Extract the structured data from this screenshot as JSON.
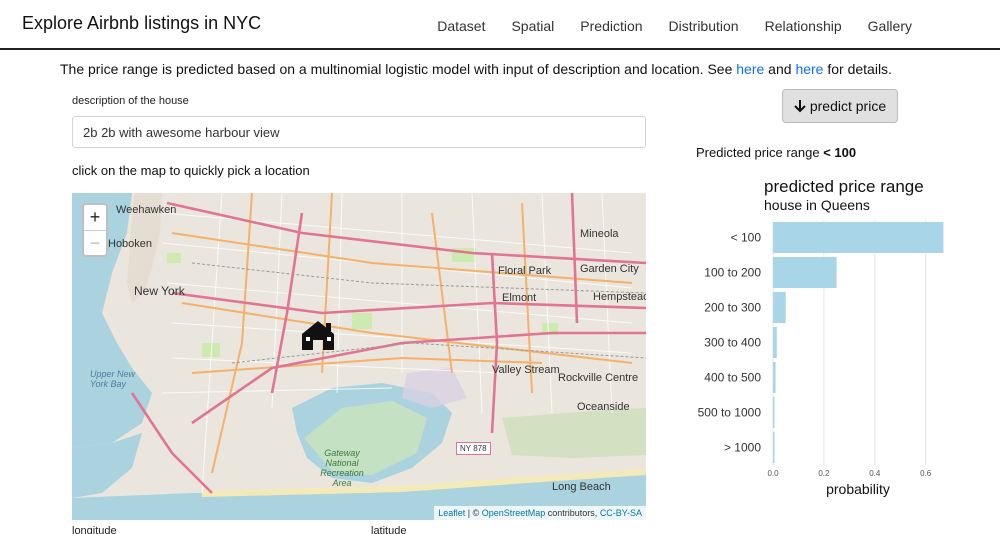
{
  "app": {
    "title": "Explore Airbnb listings in NYC",
    "nav": [
      "Dataset",
      "Spatial",
      "Prediction",
      "Distribution",
      "Relationship",
      "Gallery"
    ]
  },
  "intro": {
    "text_before": "The price range is predicted based on a multinomial logistic model with input of description and location. See ",
    "link1": "here",
    "text_mid": " and ",
    "link2": "here",
    "text_after": " for details.",
    "link_color": "#0d6efd"
  },
  "form": {
    "description_label": "description of the house",
    "description_value": "2b 2b with awesome harbour view",
    "map_hint": "click on the map to quickly pick a location",
    "longitude_label": "longitude",
    "latitude_label": "latitude"
  },
  "map": {
    "zoom_in": "+",
    "zoom_out": "−",
    "marker_icon": "house-icon",
    "labels": [
      "Weehawken",
      "Hoboken",
      "New York",
      "Upper New York Bay",
      "Gateway National Recreation Area",
      "Mineola",
      "Garden City",
      "Floral Park",
      "Elmont",
      "Hempstead",
      "Valley Stream",
      "Rockville Centre",
      "Oceanside",
      "Long Beach",
      "NY 878"
    ],
    "attribution": {
      "leaflet": "Leaflet",
      "sep1": " | © ",
      "osm": "OpenStreetMap",
      "contributors": " contributors, ",
      "license": "CC-BY-SA"
    }
  },
  "prediction": {
    "button_label": "predict price",
    "button_icon": "arrow-down-icon",
    "result_prefix": "Predicted price range ",
    "result_value": "< 100"
  },
  "chart_data": {
    "type": "bar",
    "orientation": "horizontal",
    "title": "predicted price range",
    "subtitle": "house in Queens",
    "xlabel": "probability",
    "xlim": [
      0,
      0.68
    ],
    "xticks": [
      "0.0",
      "0.2",
      "0.4",
      "0.6"
    ],
    "xtick_values": [
      0,
      0.2,
      0.4,
      0.6
    ],
    "grid": true,
    "bar_color": "#a8d5e8",
    "categories": [
      "< 100",
      "100 to 200",
      "200 to 300",
      "300 to 400",
      "400 to 500",
      "500 to 1000",
      "> 1000"
    ],
    "values": [
      0.67,
      0.25,
      0.05,
      0.015,
      0.01,
      0.004,
      0.006
    ]
  }
}
